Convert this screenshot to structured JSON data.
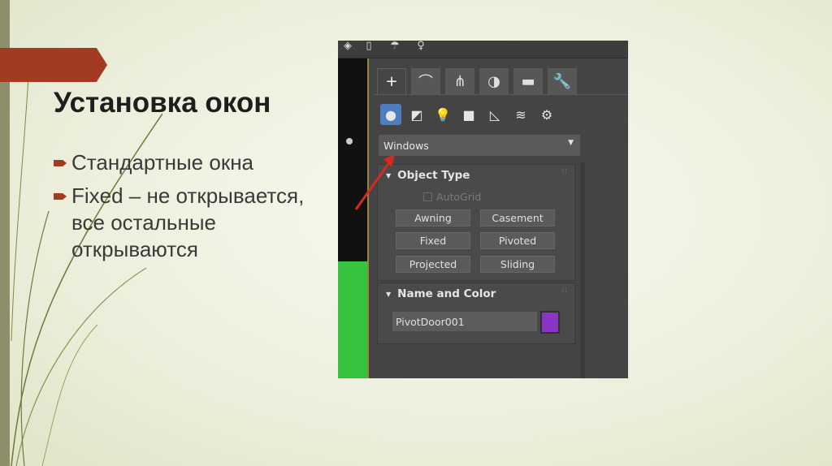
{
  "slide": {
    "title": "Установка окон",
    "bullets": [
      "Стандартные окна",
      "Fixed – не открывается, все остальные открываются"
    ],
    "accent_color": "#a33a22"
  },
  "max_ui": {
    "tabs": [
      {
        "icon": "create-plus-icon",
        "glyph": "+"
      },
      {
        "icon": "modify-curve-icon",
        "glyph": "⌒"
      },
      {
        "icon": "hierarchy-icon",
        "glyph": "⋔"
      },
      {
        "icon": "motion-icon",
        "glyph": "◑"
      },
      {
        "icon": "display-icon",
        "glyph": "▬"
      },
      {
        "icon": "utilities-wrench-icon",
        "glyph": "🔧"
      }
    ],
    "categories": [
      {
        "icon": "geometry-sphere-icon",
        "glyph": "●"
      },
      {
        "icon": "shapes-icon",
        "glyph": "◩"
      },
      {
        "icon": "lights-icon",
        "glyph": "💡"
      },
      {
        "icon": "cameras-icon",
        "glyph": "■"
      },
      {
        "icon": "helpers-icon",
        "glyph": "◺"
      },
      {
        "icon": "spacewarps-icon",
        "glyph": "≋"
      },
      {
        "icon": "systems-icon",
        "glyph": "⚙"
      }
    ],
    "dropdown": {
      "value": "Windows"
    },
    "object_type": {
      "title": "Object Type",
      "autogrid": "AutoGrid",
      "buttons": [
        "Awning",
        "Casement",
        "Fixed",
        "Pivoted",
        "Projected",
        "Sliding"
      ]
    },
    "name_and_color": {
      "title": "Name and Color",
      "name_value": "PivotDoor001",
      "color": "#8b35c6"
    }
  }
}
